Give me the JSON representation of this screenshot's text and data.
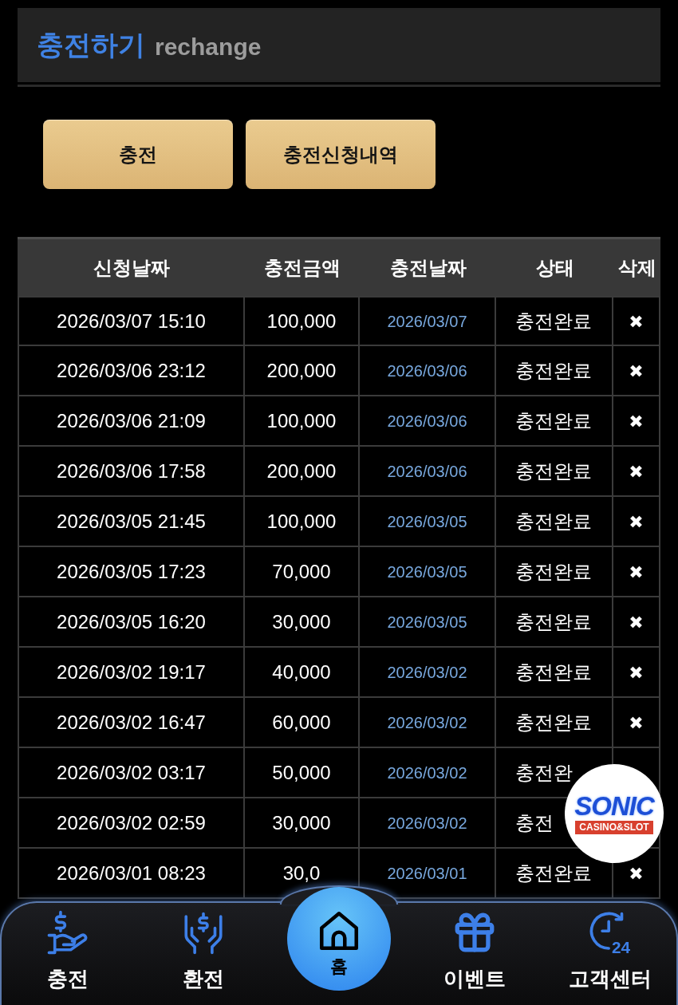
{
  "header": {
    "title": "충전하기",
    "subtitle": "rechange"
  },
  "actions": [
    {
      "label": "충전"
    },
    {
      "label": "충전신청내역"
    }
  ],
  "table": {
    "columns": [
      "신청날짜",
      "충전금액",
      "충전날짜",
      "상태",
      "삭제"
    ],
    "rows": [
      {
        "requested_at": "2026/03/07 15:10",
        "amount": "100,000",
        "charged_at": "2026/03/07",
        "status": "충전완료",
        "delete": "✖"
      },
      {
        "requested_at": "2026/03/06 23:12",
        "amount": "200,000",
        "charged_at": "2026/03/06",
        "status": "충전완료",
        "delete": "✖"
      },
      {
        "requested_at": "2026/03/06 21:09",
        "amount": "100,000",
        "charged_at": "2026/03/06",
        "status": "충전완료",
        "delete": "✖"
      },
      {
        "requested_at": "2026/03/06 17:58",
        "amount": "200,000",
        "charged_at": "2026/03/06",
        "status": "충전완료",
        "delete": "✖"
      },
      {
        "requested_at": "2026/03/05 21:45",
        "amount": "100,000",
        "charged_at": "2026/03/05",
        "status": "충전완료",
        "delete": "✖"
      },
      {
        "requested_at": "2026/03/05 17:23",
        "amount": "70,000",
        "charged_at": "2026/03/05",
        "status": "충전완료",
        "delete": "✖"
      },
      {
        "requested_at": "2026/03/05 16:20",
        "amount": "30,000",
        "charged_at": "2026/03/05",
        "status": "충전완료",
        "delete": "✖"
      },
      {
        "requested_at": "2026/03/02 19:17",
        "amount": "40,000",
        "charged_at": "2026/03/02",
        "status": "충전완료",
        "delete": "✖"
      },
      {
        "requested_at": "2026/03/02 16:47",
        "amount": "60,000",
        "charged_at": "2026/03/02",
        "status": "충전완료",
        "delete": "✖"
      },
      {
        "requested_at": "2026/03/02 03:17",
        "amount": "50,000",
        "charged_at": "2026/03/02",
        "status": "충전완"
      },
      {
        "requested_at": "2026/03/02 02:59",
        "amount": "30,000",
        "charged_at": "2026/03/02",
        "status": "충전"
      },
      {
        "requested_at": "2026/03/01 08:23",
        "amount": "30,0",
        "charged_at": "2026/03/01",
        "status": "충전완료",
        "delete": "✖"
      }
    ]
  },
  "floating_logo": {
    "wordmark": "SONIC",
    "tagline": "CASINO&SLOT"
  },
  "bottom_nav": [
    {
      "kind": "tab",
      "label": "충전"
    },
    {
      "kind": "tab",
      "label": "환전"
    },
    {
      "kind": "home",
      "label": "홈"
    },
    {
      "kind": "tab",
      "label": "이벤트"
    },
    {
      "kind": "tab",
      "label": "고객센터",
      "icon_text": "24"
    }
  ]
}
